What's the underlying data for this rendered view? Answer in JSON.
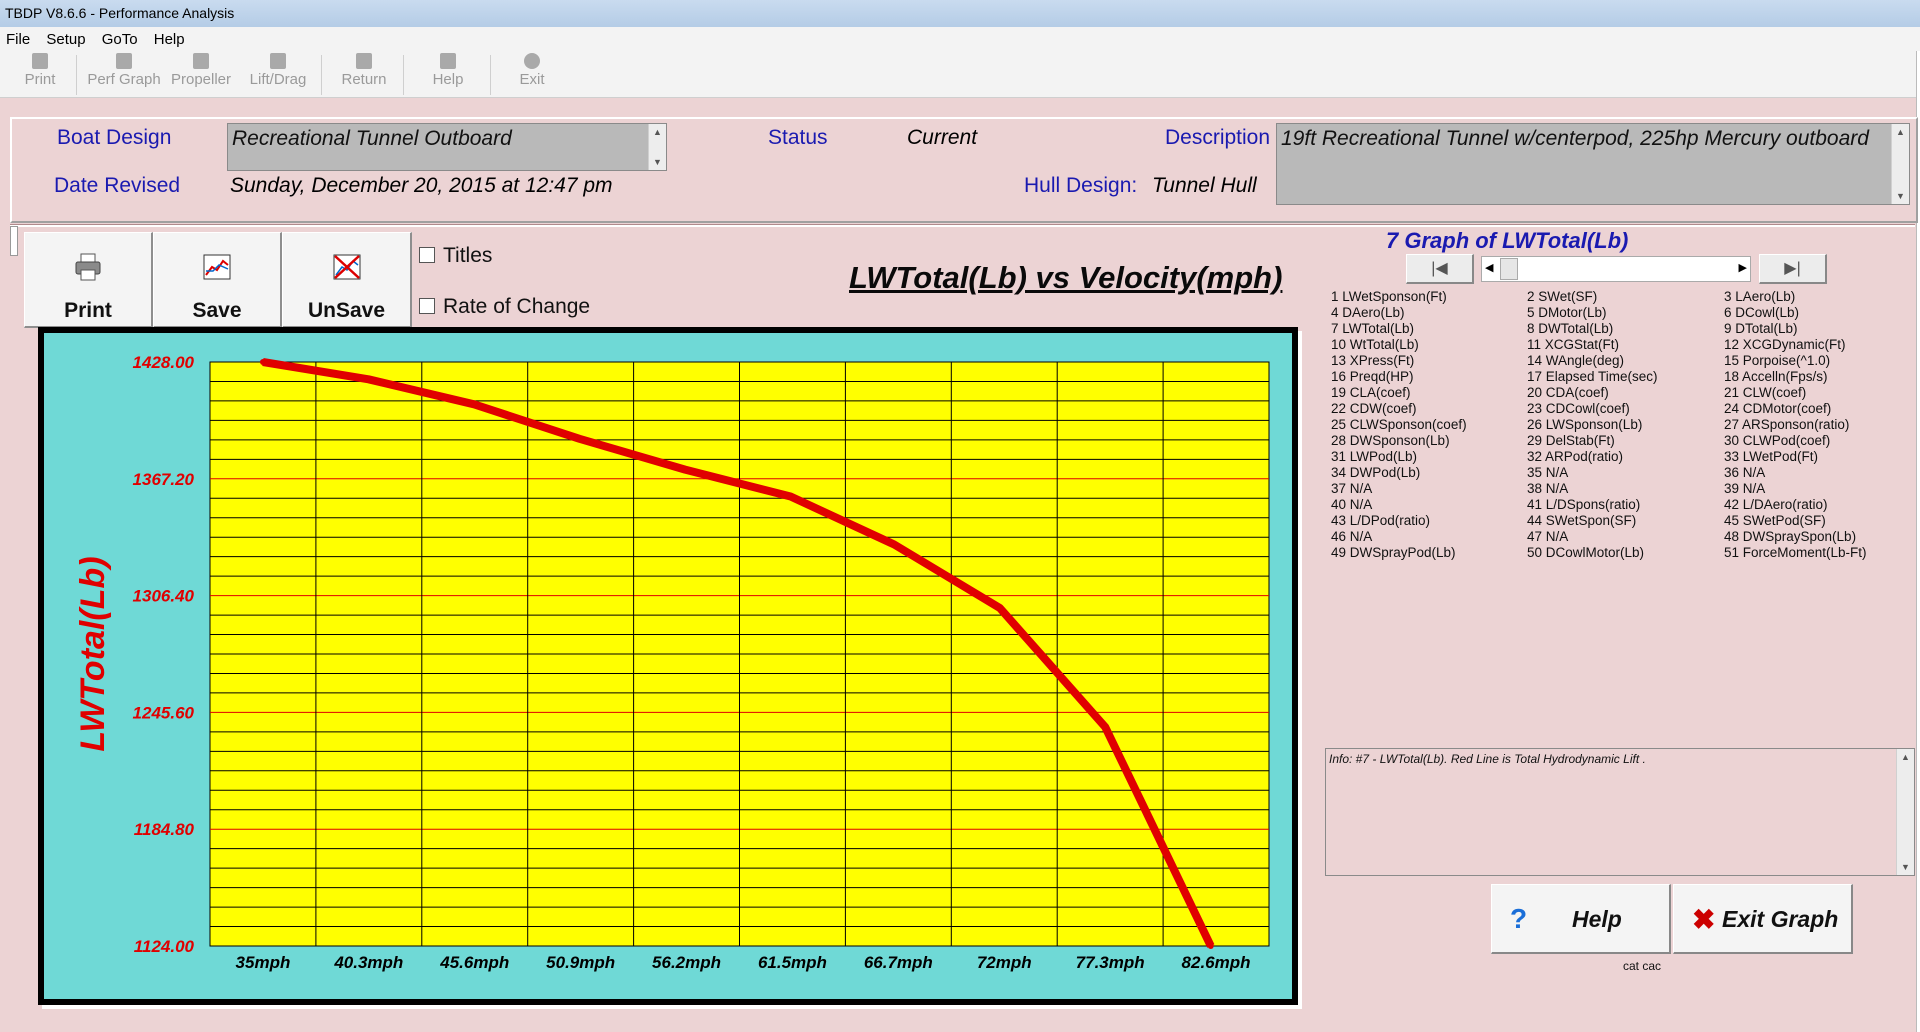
{
  "window": {
    "title": "TBDP V8.6.6 - Performance Analysis"
  },
  "menu": [
    "File",
    "Setup",
    "GoTo",
    "Help"
  ],
  "toolbar": [
    {
      "label": "Print",
      "icon": "print-icon"
    },
    {
      "label": "Perf Graph",
      "icon": "perf-graph-icon"
    },
    {
      "label": "Propeller",
      "icon": "propeller-icon"
    },
    {
      "label": "Lift/Drag",
      "icon": "lift-drag-icon"
    },
    {
      "label": "Return",
      "icon": "return-icon"
    },
    {
      "label": "Help",
      "icon": "help-icon"
    },
    {
      "label": "Exit",
      "icon": "exit-icon"
    }
  ],
  "info": {
    "boat_design_label": "Boat Design",
    "boat_design_value": "Recreational Tunnel Outboard",
    "status_label": "Status",
    "status_value": "Current",
    "description_label": "Description",
    "description_value": "19ft Recreational Tunnel w/centerpod, 225hp Mercury outboard",
    "date_revised_label": "Date Revised",
    "date_revised_value": "Sunday, December 20, 2015 at 12:47 pm",
    "hull_design_label": "Hull Design:",
    "hull_design_value": "Tunnel Hull"
  },
  "graph_buttons": {
    "print": "Print",
    "save": "Save",
    "unsave": "UnSave"
  },
  "options": {
    "titles": "Titles",
    "rate_of_change": "Rate of Change"
  },
  "graph_nav": {
    "title": "7 Graph of LWTotal(Lb)"
  },
  "graph_list": [
    "1 LWetSponson(Ft)",
    "2 SWet(SF)",
    "3 LAero(Lb)",
    "4 DAero(Lb)",
    "5 DMotor(Lb)",
    "6 DCowl(Lb)",
    "7 LWTotal(Lb)",
    "8 DWTotal(Lb)",
    "9 DTotal(Lb)",
    "10 WtTotal(Lb)",
    "11 XCGStat(Ft)",
    "12 XCGDynamic(Ft)",
    "13 XPress(Ft)",
    "14 WAngle(deg)",
    "15 Porpoise(^1.0)",
    "16 Preqd(HP)",
    "17 Elapsed Time(sec)",
    "18 Accelln(Fps/s)",
    "19 CLA(coef)",
    "20 CDA(coef)",
    "21 CLW(coef)",
    "22 CDW(coef)",
    "23 CDCowl(coef)",
    "24 CDMotor(coef)",
    "25 CLWSponson(coef)",
    "26 LWSponson(Lb)",
    "27 ARSponson(ratio)",
    "28 DWSponson(Lb)",
    "29 DelStab(Ft)",
    "30 CLWPod(coef)",
    "31 LWPod(Lb)",
    "32 ARPod(ratio)",
    "33 LWetPod(Ft)",
    "34 DWPod(Lb)",
    "35 N/A",
    "36 N/A",
    "37 N/A",
    "38 N/A",
    "39 N/A",
    "40 N/A",
    "41 L/DSpons(ratio)",
    "42 L/DAero(ratio)",
    "43 L/DPod(ratio)",
    "44 SWetSpon(SF)",
    "45 SWetPod(SF)",
    "46 N/A",
    "47 N/A",
    "48 DWSpraySpon(Lb)",
    "49 DWSprayPod(Lb)",
    "50 DCowlMotor(Lb)",
    "51 ForceMoment(Lb-Ft)"
  ],
  "info_text": "Info: #7 - LWTotal(Lb). Red Line is Total Hydrodynamic Lift .",
  "actions": {
    "help": "Help",
    "exit": "Exit Graph"
  },
  "footnote": "cat cac",
  "colors": {
    "plot_bg": "#ffff00",
    "frame_bg": "#6fd9d6",
    "line": "#e00000",
    "label_blue": "#1a1ab0"
  },
  "chart_data": {
    "type": "line",
    "title": "LWTotal(Lb) vs Velocity(mph)",
    "ylabel": "LWTotal(Lb)",
    "xlabel": "",
    "categories": [
      "35mph",
      "40.3mph",
      "45.6mph",
      "50.9mph",
      "56.2mph",
      "61.5mph",
      "66.7mph",
      "72mph",
      "77.3mph",
      "82.6mph"
    ],
    "ytick_labels": [
      "1428.00",
      "1367.20",
      "1306.40",
      "1245.60",
      "1184.80",
      "1124.00"
    ],
    "ylim": [
      1124,
      1428
    ],
    "series": [
      {
        "x": [
          35,
          40.3,
          45.6,
          50.9,
          56.2,
          61.5,
          66.7,
          72,
          77.3,
          82.6
        ],
        "y": [
          1428,
          1419,
          1406,
          1388,
          1372,
          1358,
          1333,
          1300,
          1238,
          1124
        ]
      }
    ]
  }
}
